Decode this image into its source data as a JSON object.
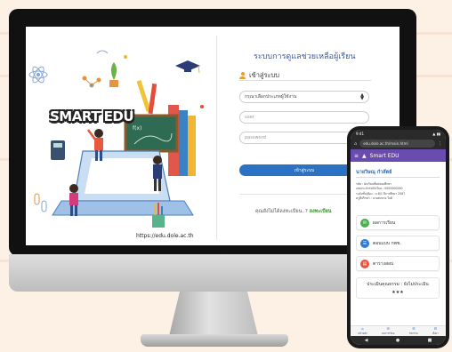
{
  "desktop": {
    "brand_text": "SMART EDU",
    "url_text": "https://edu.dole.ac.th",
    "login": {
      "title": "ระบบการดูแลช่วยเหลือผู้เรียน",
      "heading": "เข้าสู่ระบบ",
      "select_value": "กรุณาเลือกประเภทผู้ใช้งาน",
      "user_placeholder": "user",
      "password_placeholder": "password",
      "submit_label": "เข้าสู่ระบบ",
      "register_prompt": "คุณยังไม่ได้ลงทะเบียน..?",
      "register_link": "ลงทะเบียน"
    }
  },
  "mobile": {
    "status_time": "9:41",
    "status_right": "▲ ▮▮",
    "url": "edu.dole.ac.th/main.html",
    "app_title": "Smart EDU",
    "user_name": "นายวิษณุ  กำสัตย์",
    "info_lines": [
      "รหัส : นักเรียนชั้นมัธยมศึกษา",
      "เลขประจำตัวนักเรียน : 0000000000",
      "ระดับชั้น/ห้อง : ม.6/1 ปีการศึกษา 2567",
      "ครูที่ปรึกษา : นายสมชาย ใจดี"
    ],
    "menu": [
      {
        "label": "ผลการเรียน",
        "color": "#4caf50",
        "icon": "✉"
      },
      {
        "label": "ตอบแบบ กพช.",
        "color": "#2f7bd6",
        "icon": "☰"
      },
      {
        "label": "ตารางสอบ",
        "color": "#e8553e",
        "icon": "▤"
      }
    ],
    "eval_label": "ประเมินคุณธรรม : ยังไม่ประเมิน",
    "eval_stars": "★★★",
    "bottom_nav": [
      {
        "label": "หน้าหลัก",
        "icon": "⌂"
      },
      {
        "label": "ผลการเรียน",
        "icon": "✉"
      },
      {
        "label": "กิจกรรม",
        "icon": "☰"
      },
      {
        "label": "ตั้งค่า",
        "icon": "⚙"
      }
    ],
    "sys_nav": [
      "◀",
      "●",
      "■"
    ]
  },
  "colors": {
    "accent": "#2c72c4",
    "app_bar": "#6a4bb0",
    "title": "#3659a8"
  }
}
